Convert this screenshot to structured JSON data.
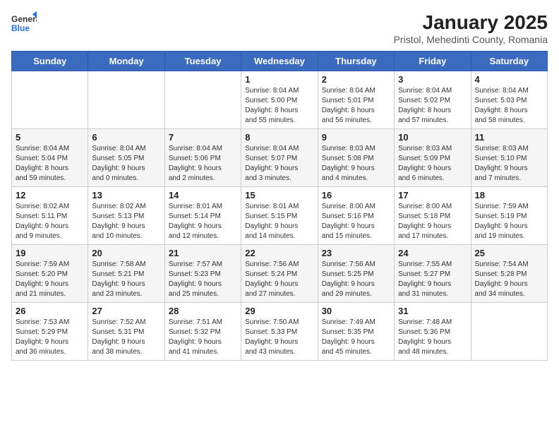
{
  "logo": {
    "text_general": "General",
    "text_blue": "Blue"
  },
  "title": "January 2025",
  "subtitle": "Pristol, Mehedinti County, Romania",
  "weekdays": [
    "Sunday",
    "Monday",
    "Tuesday",
    "Wednesday",
    "Thursday",
    "Friday",
    "Saturday"
  ],
  "weeks": [
    [
      {
        "day": "",
        "detail": ""
      },
      {
        "day": "",
        "detail": ""
      },
      {
        "day": "",
        "detail": ""
      },
      {
        "day": "1",
        "detail": "Sunrise: 8:04 AM\nSunset: 5:00 PM\nDaylight: 8 hours\nand 55 minutes."
      },
      {
        "day": "2",
        "detail": "Sunrise: 8:04 AM\nSunset: 5:01 PM\nDaylight: 8 hours\nand 56 minutes."
      },
      {
        "day": "3",
        "detail": "Sunrise: 8:04 AM\nSunset: 5:02 PM\nDaylight: 8 hours\nand 57 minutes."
      },
      {
        "day": "4",
        "detail": "Sunrise: 8:04 AM\nSunset: 5:03 PM\nDaylight: 8 hours\nand 58 minutes."
      }
    ],
    [
      {
        "day": "5",
        "detail": "Sunrise: 8:04 AM\nSunset: 5:04 PM\nDaylight: 8 hours\nand 59 minutes."
      },
      {
        "day": "6",
        "detail": "Sunrise: 8:04 AM\nSunset: 5:05 PM\nDaylight: 9 hours\nand 0 minutes."
      },
      {
        "day": "7",
        "detail": "Sunrise: 8:04 AM\nSunset: 5:06 PM\nDaylight: 9 hours\nand 2 minutes."
      },
      {
        "day": "8",
        "detail": "Sunrise: 8:04 AM\nSunset: 5:07 PM\nDaylight: 9 hours\nand 3 minutes."
      },
      {
        "day": "9",
        "detail": "Sunrise: 8:03 AM\nSunset: 5:08 PM\nDaylight: 9 hours\nand 4 minutes."
      },
      {
        "day": "10",
        "detail": "Sunrise: 8:03 AM\nSunset: 5:09 PM\nDaylight: 9 hours\nand 6 minutes."
      },
      {
        "day": "11",
        "detail": "Sunrise: 8:03 AM\nSunset: 5:10 PM\nDaylight: 9 hours\nand 7 minutes."
      }
    ],
    [
      {
        "day": "12",
        "detail": "Sunrise: 8:02 AM\nSunset: 5:11 PM\nDaylight: 9 hours\nand 9 minutes."
      },
      {
        "day": "13",
        "detail": "Sunrise: 8:02 AM\nSunset: 5:13 PM\nDaylight: 9 hours\nand 10 minutes."
      },
      {
        "day": "14",
        "detail": "Sunrise: 8:01 AM\nSunset: 5:14 PM\nDaylight: 9 hours\nand 12 minutes."
      },
      {
        "day": "15",
        "detail": "Sunrise: 8:01 AM\nSunset: 5:15 PM\nDaylight: 9 hours\nand 14 minutes."
      },
      {
        "day": "16",
        "detail": "Sunrise: 8:00 AM\nSunset: 5:16 PM\nDaylight: 9 hours\nand 15 minutes."
      },
      {
        "day": "17",
        "detail": "Sunrise: 8:00 AM\nSunset: 5:18 PM\nDaylight: 9 hours\nand 17 minutes."
      },
      {
        "day": "18",
        "detail": "Sunrise: 7:59 AM\nSunset: 5:19 PM\nDaylight: 9 hours\nand 19 minutes."
      }
    ],
    [
      {
        "day": "19",
        "detail": "Sunrise: 7:59 AM\nSunset: 5:20 PM\nDaylight: 9 hours\nand 21 minutes."
      },
      {
        "day": "20",
        "detail": "Sunrise: 7:58 AM\nSunset: 5:21 PM\nDaylight: 9 hours\nand 23 minutes."
      },
      {
        "day": "21",
        "detail": "Sunrise: 7:57 AM\nSunset: 5:23 PM\nDaylight: 9 hours\nand 25 minutes."
      },
      {
        "day": "22",
        "detail": "Sunrise: 7:56 AM\nSunset: 5:24 PM\nDaylight: 9 hours\nand 27 minutes."
      },
      {
        "day": "23",
        "detail": "Sunrise: 7:56 AM\nSunset: 5:25 PM\nDaylight: 9 hours\nand 29 minutes."
      },
      {
        "day": "24",
        "detail": "Sunrise: 7:55 AM\nSunset: 5:27 PM\nDaylight: 9 hours\nand 31 minutes."
      },
      {
        "day": "25",
        "detail": "Sunrise: 7:54 AM\nSunset: 5:28 PM\nDaylight: 9 hours\nand 34 minutes."
      }
    ],
    [
      {
        "day": "26",
        "detail": "Sunrise: 7:53 AM\nSunset: 5:29 PM\nDaylight: 9 hours\nand 36 minutes."
      },
      {
        "day": "27",
        "detail": "Sunrise: 7:52 AM\nSunset: 5:31 PM\nDaylight: 9 hours\nand 38 minutes."
      },
      {
        "day": "28",
        "detail": "Sunrise: 7:51 AM\nSunset: 5:32 PM\nDaylight: 9 hours\nand 41 minutes."
      },
      {
        "day": "29",
        "detail": "Sunrise: 7:50 AM\nSunset: 5:33 PM\nDaylight: 9 hours\nand 43 minutes."
      },
      {
        "day": "30",
        "detail": "Sunrise: 7:49 AM\nSunset: 5:35 PM\nDaylight: 9 hours\nand 45 minutes."
      },
      {
        "day": "31",
        "detail": "Sunrise: 7:48 AM\nSunset: 5:36 PM\nDaylight: 9 hours\nand 48 minutes."
      },
      {
        "day": "",
        "detail": ""
      }
    ]
  ]
}
